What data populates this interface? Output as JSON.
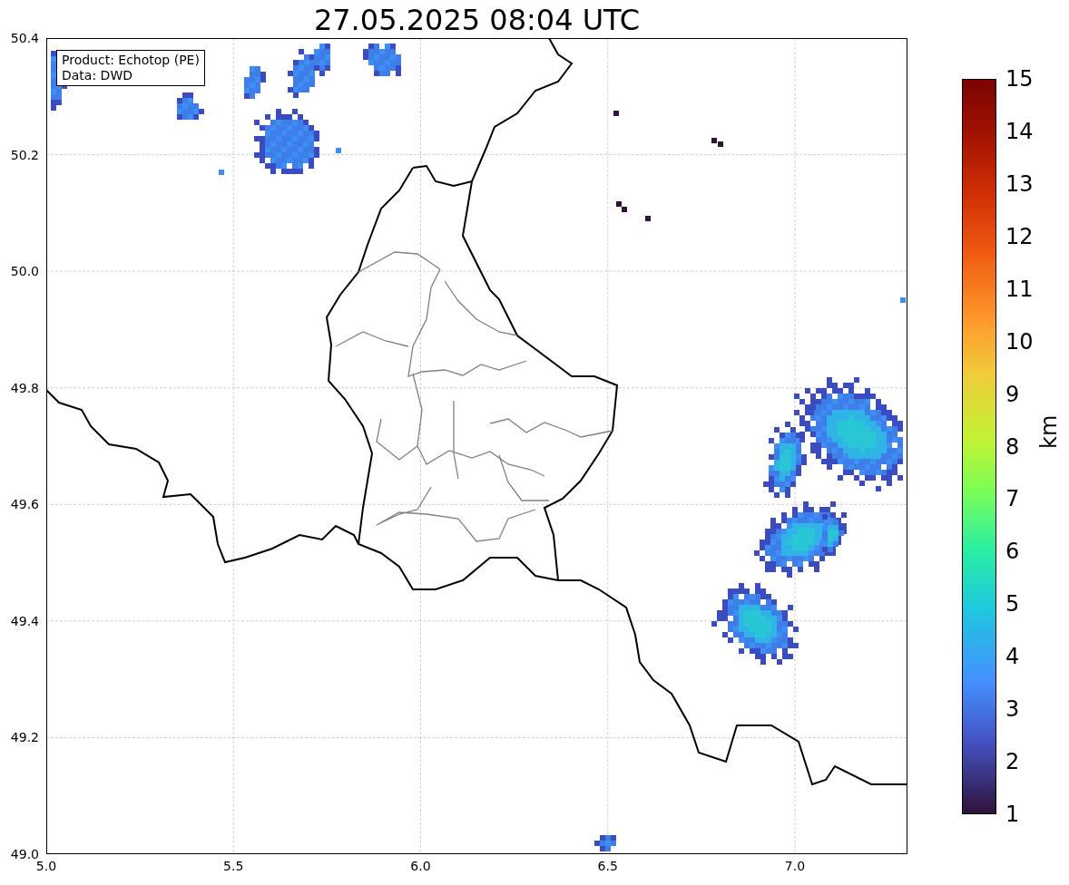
{
  "title": "27.05.2025 08:04 UTC",
  "legend": [
    "Product: Echotop (PE)",
    "Data: DWD"
  ],
  "x_axis": {
    "ticks": [
      "5.0",
      "5.5",
      "6.0",
      "6.5",
      "7.0"
    ]
  },
  "y_axis": {
    "ticks": [
      "50.4",
      "50.2",
      "50.0",
      "49.8",
      "49.6",
      "49.4",
      "49.2",
      "49.0"
    ]
  },
  "colorbar": {
    "label": "km",
    "ticks": [
      "15",
      "14",
      "13",
      "12",
      "11",
      "10",
      "9",
      "8",
      "7",
      "6",
      "5",
      "4",
      "3",
      "2",
      "1"
    ]
  }
}
